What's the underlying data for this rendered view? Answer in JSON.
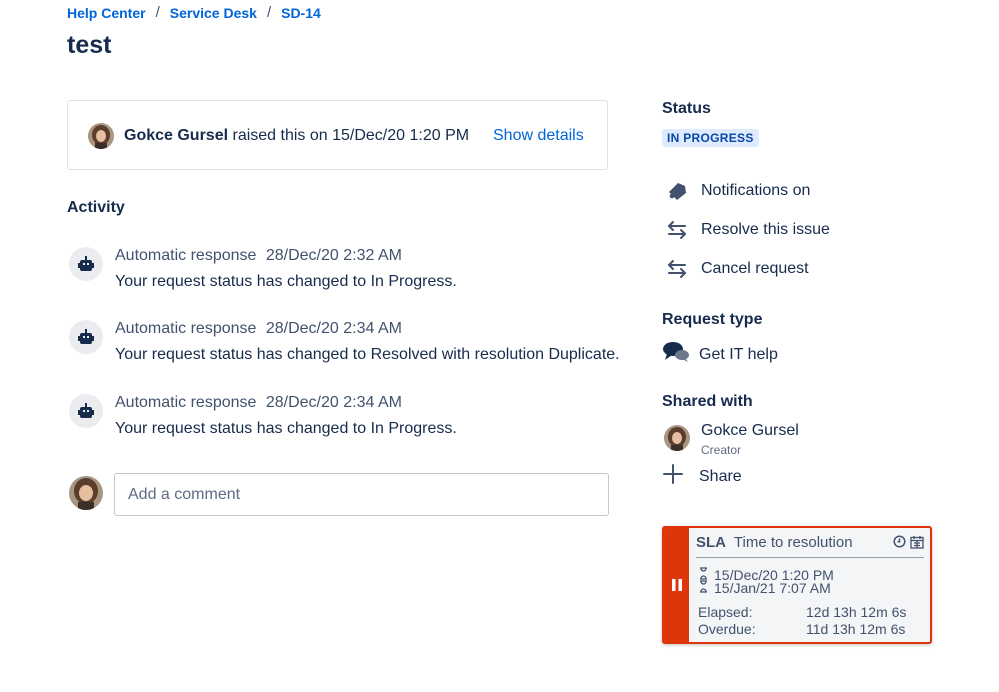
{
  "breadcrumb": {
    "items": [
      "Help Center",
      "Service Desk",
      "SD-14"
    ],
    "separator": "/"
  },
  "page": {
    "title": "test"
  },
  "raised": {
    "name": "Gokce Gursel",
    "text": "raised this on 15/Dec/20 1:20 PM",
    "show_details": "Show details"
  },
  "activity": {
    "heading": "Activity",
    "items": [
      {
        "author": "Automatic response",
        "time": "28/Dec/20 2:32 AM",
        "message": "Your request status has changed to In Progress."
      },
      {
        "author": "Automatic response",
        "time": "28/Dec/20 2:34 AM",
        "message": "Your request status has changed to Resolved with resolution Duplicate."
      },
      {
        "author": "Automatic response",
        "time": "28/Dec/20 2:34 AM",
        "message": "Your request status has changed to In Progress."
      }
    ]
  },
  "comment": {
    "placeholder": "Add a comment"
  },
  "sidebar": {
    "status_heading": "Status",
    "status_value": "IN PROGRESS",
    "actions": [
      {
        "label": "Notifications on",
        "icon": "bell-icon"
      },
      {
        "label": "Resolve this issue",
        "icon": "transition-arrows-icon"
      },
      {
        "label": "Cancel request",
        "icon": "transition-arrows-icon"
      }
    ],
    "request_type_heading": "Request type",
    "request_type": "Get IT help",
    "shared_heading": "Shared with",
    "shared_user": {
      "name": "Gokce Gursel",
      "role": "Creator"
    },
    "share_label": "Share"
  },
  "sla": {
    "label": "SLA",
    "title": "Time to resolution",
    "start": "15/Dec/20 1:20 PM",
    "due": "15/Jan/21 7:07 AM",
    "elapsed_label": "Elapsed:",
    "elapsed_value": "12d 13h 12m 6s",
    "overdue_label": "Overdue:",
    "overdue_value": "11d 13h 12m 6s",
    "state": "paused"
  },
  "colors": {
    "link": "#0065d9",
    "text": "#172b4d",
    "lozenge_bg": "#deebff",
    "lozenge_text": "#0747a6",
    "sla_breach": "#de350b"
  }
}
